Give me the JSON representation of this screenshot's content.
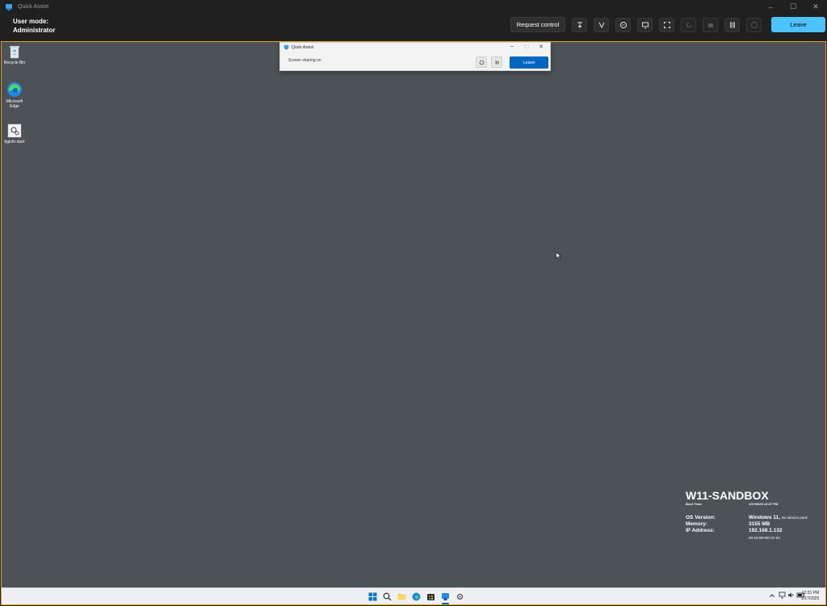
{
  "window": {
    "title": "Quick Assist",
    "controls": [
      "–",
      "☐",
      "✕"
    ]
  },
  "toolbar": {
    "user_mode_label": "User mode:",
    "user_mode_value": "Administrator",
    "request_control": "Request control",
    "leave": "Leave"
  },
  "desktop": {
    "icons": [
      {
        "label": "Recycle Bin"
      },
      {
        "label": "Microsoft Edge"
      },
      {
        "label": "bginfo-start"
      }
    ]
  },
  "mini_window": {
    "title": "Quick Assist",
    "status": "Screen sharing on",
    "leave": "Leave",
    "controls": [
      "–",
      "☐",
      "✕"
    ]
  },
  "bginfo": {
    "hostname": "W11-SANDBOX",
    "boot_time_label": "Boot Time:",
    "boot_time_value": "1/17/2025 12:27 PM",
    "os_label": "OS Version:",
    "os_value": "Windows 11,",
    "os_extra": "No service pack",
    "memory_label": "Memory:",
    "memory_value": "3155 MB",
    "ip_label": "IP Address:",
    "ip_value": "192.168.1.132",
    "mac_value": "00-15-5D-B0-01-04"
  },
  "taskbar": {
    "time": "12:31 PM",
    "date": "1/17/2025"
  },
  "colors": {
    "accent_leave": "#4cc2ff",
    "frame": "#e5a600",
    "desktop": "#4d5257",
    "mini_leave": "#0067c0"
  }
}
